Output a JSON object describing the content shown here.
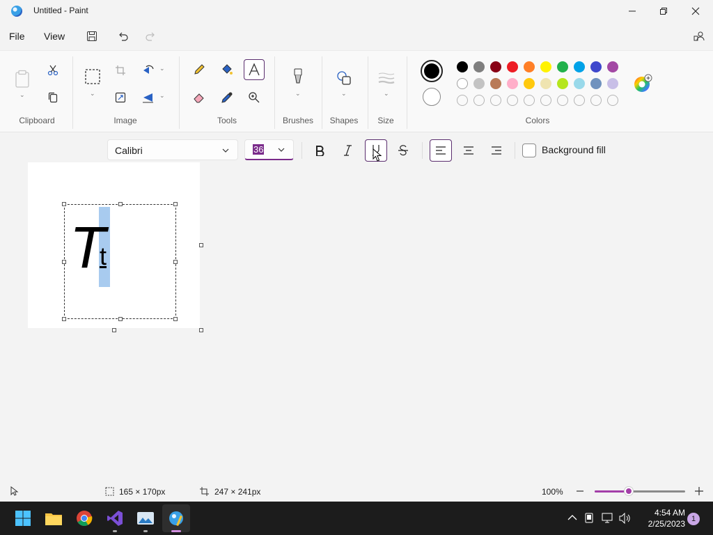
{
  "window": {
    "title": "Untitled - Paint"
  },
  "menu": {
    "file": "File",
    "view": "View"
  },
  "ribbon": {
    "groups": {
      "clipboard": "Clipboard",
      "image": "Image",
      "tools": "Tools",
      "brushes": "Brushes",
      "shapes": "Shapes",
      "size": "Size",
      "colors": "Colors"
    },
    "primary_color": "#000000",
    "secondary_color": "#ffffff",
    "palette": [
      "#000000",
      "#7f7f7f",
      "#880015",
      "#ed1c24",
      "#ff7f27",
      "#fff200",
      "#22b14c",
      "#00a2e8",
      "#3f48cc",
      "#a349a4",
      "#ffffff",
      "#c3c3c3",
      "#b97a57",
      "#ffaec9",
      "#ffc90e",
      "#efe4b0",
      "#b5e61d",
      "#99d9ea",
      "#7092be",
      "#c8bfe7"
    ]
  },
  "textbar": {
    "font": "Calibri",
    "size": "36",
    "background_fill_label": "Background fill"
  },
  "canvas": {
    "big_letter": "T",
    "small_letter": "t"
  },
  "status": {
    "selection_size": "165 × 170px",
    "canvas_size": "247 × 241px",
    "zoom": "100%",
    "zoom_level": 0.38
  },
  "taskbar": {
    "time": "4:54 AM",
    "date": "2/25/2023",
    "notification_count": "1"
  },
  "colors": {
    "accent": "#7a2b8a",
    "selection": "#a8cbef"
  }
}
